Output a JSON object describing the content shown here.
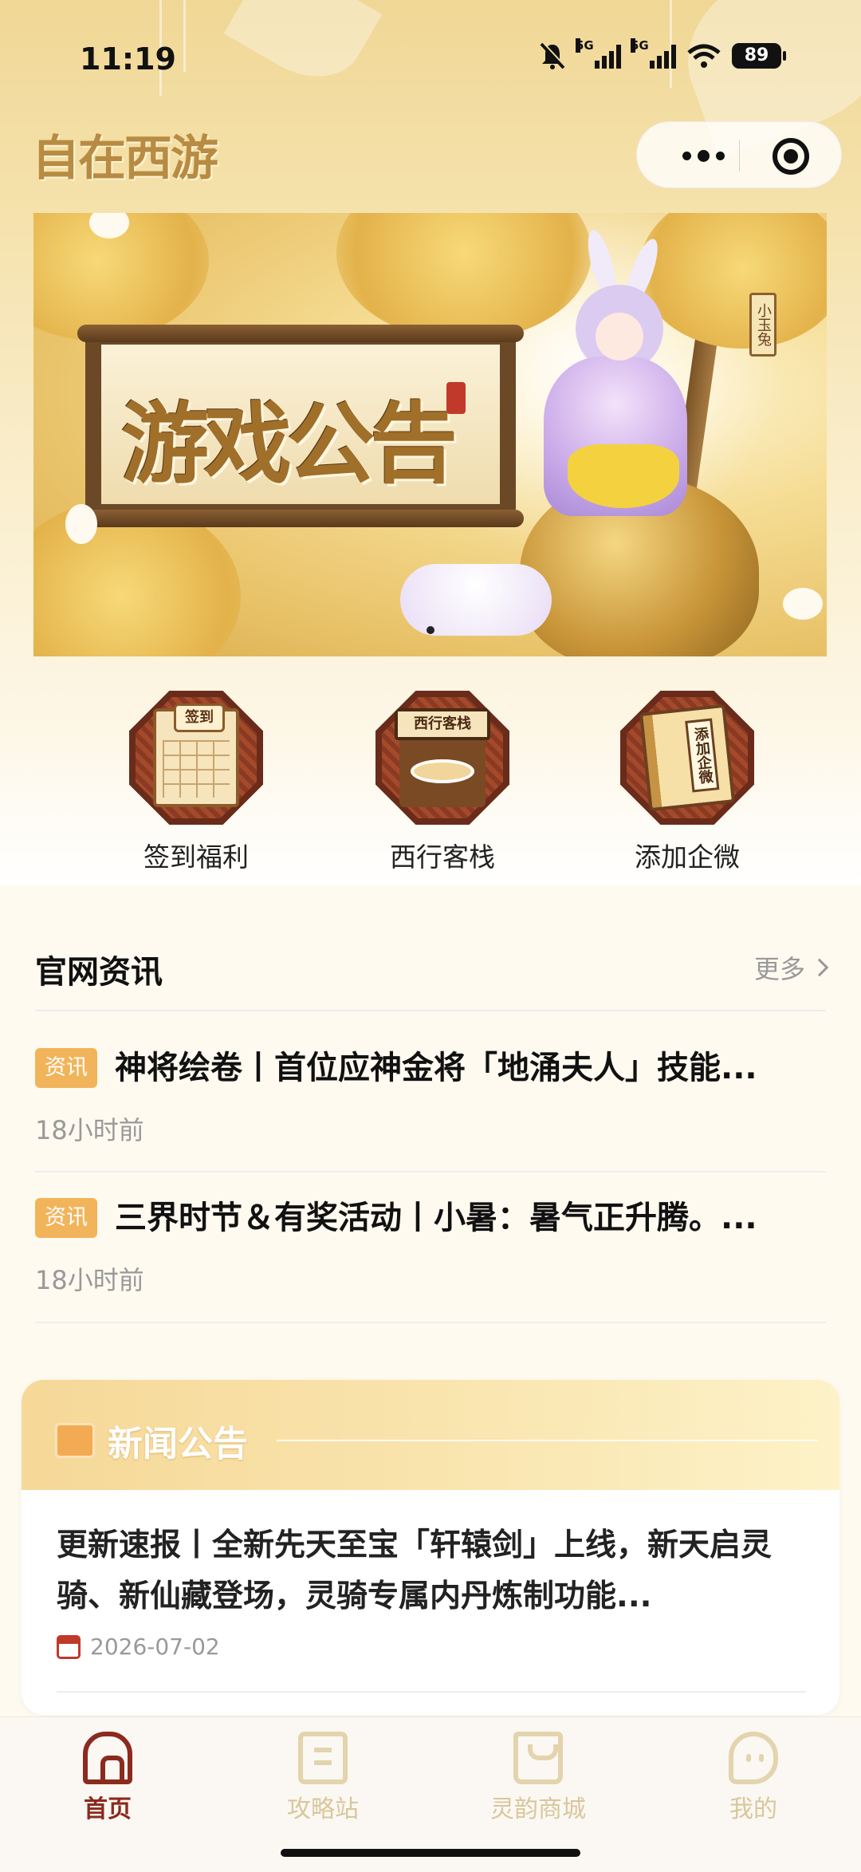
{
  "status_bar": {
    "time": "11:19",
    "signal1": "5G",
    "signal2": "5G",
    "battery": "89"
  },
  "header": {
    "logo_text": "自在西游"
  },
  "banner": {
    "title": "游戏公告",
    "character_tag": "小玉兔"
  },
  "quick_entries": [
    {
      "label": "签到福利",
      "icon_text": "签到",
      "icon": "calendar-icon"
    },
    {
      "label": "西行客栈",
      "icon_text": "西行客栈",
      "icon": "inn-icon"
    },
    {
      "label": "添加企微",
      "icon_text": "添加企微",
      "icon": "book-icon"
    }
  ],
  "news_section": {
    "title": "官网资讯",
    "more_label": "更多",
    "items": [
      {
        "tag": "资讯",
        "title": "神将绘卷丨首位应神金将「地涌夫人」技能...",
        "time": "18小时前"
      },
      {
        "tag": "资讯",
        "title": "三界时节＆有奖活动丨小暑：暑气正升腾。...",
        "time": "18小时前"
      }
    ]
  },
  "notice_card": {
    "title": "新闻公告",
    "item": {
      "title": "更新速报丨全新先天至宝「轩辕剑」上线，新天启灵骑、新仙藏登场，灵骑专属内丹炼制功能...",
      "date": "2026-07-02"
    }
  },
  "tabbar": {
    "tabs": [
      {
        "label": "首页",
        "icon": "home-icon",
        "active": true
      },
      {
        "label": "攻略站",
        "icon": "guide-icon",
        "active": false
      },
      {
        "label": "灵韵商城",
        "icon": "shop-icon",
        "active": false
      },
      {
        "label": "我的",
        "icon": "profile-icon",
        "active": false
      }
    ]
  },
  "colors": {
    "accent": "#8c2a1e",
    "tag": "#f2b45a",
    "inactive_tab": "#d9c79b"
  }
}
